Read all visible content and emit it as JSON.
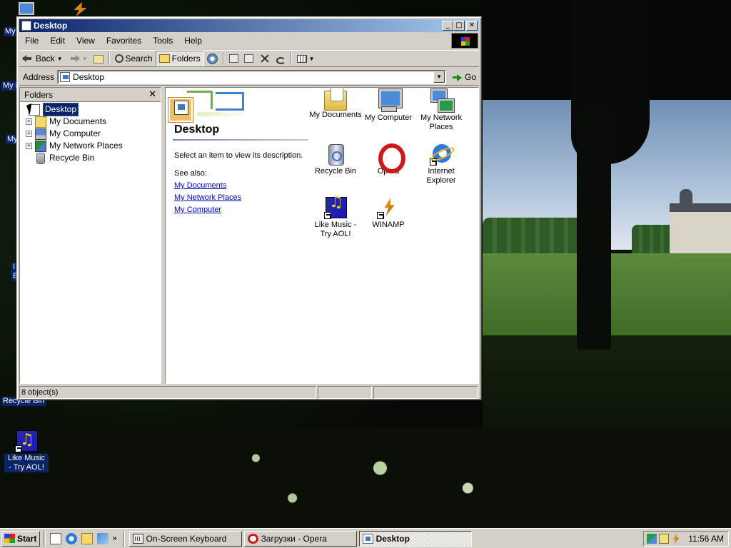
{
  "desktop": {
    "icons": [
      {
        "label": "Like Music - Try AOL!",
        "icon": "aol-music-icon"
      },
      {
        "label": "Recycle Bin",
        "icon": "recycle-bin-icon"
      }
    ],
    "partial_labels": [
      "My",
      "My D",
      "My",
      "I",
      "E",
      "Recycle Bin"
    ]
  },
  "window": {
    "title": "Desktop",
    "buttons": {
      "minimize": "_",
      "maximize": "□",
      "close": "✕"
    },
    "menu": [
      "File",
      "Edit",
      "View",
      "Favorites",
      "Tools",
      "Help"
    ],
    "toolbar": {
      "back": "Back",
      "search": "Search",
      "folders": "Folders"
    },
    "address": {
      "label": "Address",
      "value": "Desktop",
      "go": "Go"
    },
    "folders_pane": {
      "title": "Folders",
      "close": "✕",
      "tree": [
        {
          "label": "Desktop",
          "expander": "",
          "selected": true,
          "icon": "desktop-icon"
        },
        {
          "label": "My Documents",
          "expander": "+",
          "icon": "folder-icon"
        },
        {
          "label": "My Computer",
          "expander": "+",
          "icon": "computer-icon"
        },
        {
          "label": "My Network Places",
          "expander": "+",
          "icon": "network-icon"
        },
        {
          "label": "Recycle Bin",
          "expander": "",
          "icon": "recycle-bin-icon"
        }
      ]
    },
    "webview": {
      "title": "Desktop",
      "description": "Select an item to view its description.",
      "see_also": "See also:",
      "links": [
        "My Documents",
        "My Network Places",
        "My Computer"
      ]
    },
    "items": [
      {
        "label": "My Documents",
        "icon": "my-documents-icon",
        "shortcut": false
      },
      {
        "label": "My Computer",
        "icon": "my-computer-icon",
        "shortcut": false
      },
      {
        "label": "My Network Places",
        "icon": "network-places-icon",
        "shortcut": false
      },
      {
        "label": "Recycle Bin",
        "icon": "recycle-bin-icon",
        "shortcut": false
      },
      {
        "label": "Opera",
        "icon": "opera-icon",
        "shortcut": false
      },
      {
        "label": "Internet Explorer",
        "icon": "internet-explorer-icon",
        "shortcut": true
      },
      {
        "label": "Like Music - Try AOL!",
        "icon": "aol-music-icon",
        "shortcut": true
      },
      {
        "label": "WINAMP",
        "icon": "winamp-icon",
        "shortcut": true
      }
    ],
    "status": {
      "objects": "8 object(s)"
    }
  },
  "taskbar": {
    "start": "Start",
    "quick_launch_more": "»",
    "tasks": [
      {
        "label": "On-Screen Keyboard",
        "icon": "keyboard-icon",
        "active": false
      },
      {
        "label": "Загрузки - Opera",
        "icon": "opera-icon",
        "active": false
      },
      {
        "label": "Desktop",
        "icon": "desktop-icon",
        "active": true
      }
    ],
    "clock": "11:56 AM"
  }
}
